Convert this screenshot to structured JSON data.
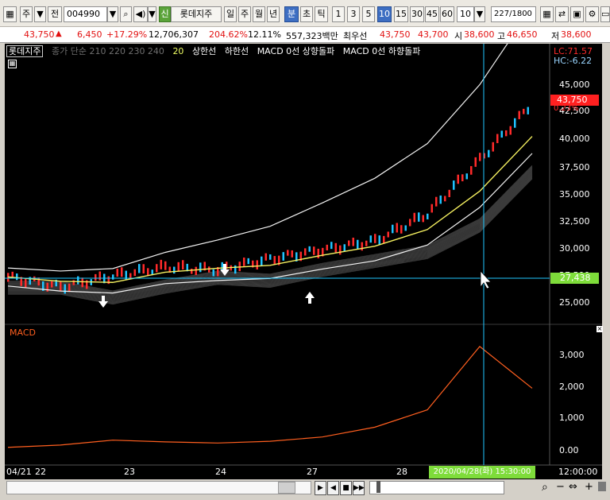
{
  "toolbar": {
    "mode": "주",
    "market": "전",
    "code": "004990",
    "badge": "신",
    "stock_name": "롯데지주",
    "periods": [
      "일",
      "주",
      "월",
      "년",
      "분",
      "초",
      "틱"
    ],
    "active_period": "분",
    "minutes": [
      "1",
      "3",
      "5",
      "10",
      "15",
      "30",
      "45",
      "60"
    ],
    "active_minute": "10",
    "interval": "10",
    "count": "227",
    "count_total": "/1800",
    "colors": {
      "active": "#3d6ec2",
      "badge": "#5aa339"
    }
  },
  "quote": {
    "price": "43,750",
    "arrow": "▲",
    "change": "6,450",
    "change_pct": "+17.29%",
    "volume": "12,706,307",
    "volume_ratio": "204.62%",
    "turnover": "12.11%",
    "amount": "557,323백만",
    "best_ask_label": "최우선",
    "best_ask": "43,750",
    "best_bid": "43,700",
    "open_label": "시",
    "open": "38,600",
    "high_label": "고",
    "high": "46,650",
    "low_label": "저",
    "low": "38,600"
  },
  "legend": {
    "stock": "롯데지주",
    "ma": "종가 단순 210 220 230 240",
    "n": "20",
    "upper": "상한선",
    "lower": "하한선",
    "macd_up": "MACD 0선 상향돌파",
    "macd_down": "MACD 0선 하향돌파"
  },
  "price_axis": {
    "labels": [
      "45,000",
      "42,500",
      "40,000",
      "37,500",
      "35,000",
      "32,500",
      "30,000",
      "27,500",
      "25,000"
    ],
    "lc": "LC:71.57",
    "hc": "HC:-6.22",
    "current": "43,750",
    "current_pct": "0.23%",
    "crosshair": "27,438"
  },
  "macd_panel": {
    "title": "MACD",
    "labels": [
      "3,000",
      "2,000",
      "1,000",
      "0.00"
    ],
    "close_mark": "×"
  },
  "time_axis": {
    "labels": [
      "04/21",
      "22",
      "23",
      "24",
      "27",
      "28"
    ],
    "crosshair": "2020/04/28(화) 15:30:00",
    "last": "12:00:00"
  },
  "chart_data": {
    "type": "line",
    "title": "",
    "price": {
      "x": [
        "04/21",
        "22",
        "23",
        "24",
        "27",
        "28"
      ],
      "close": [
        26500,
        25500,
        26600,
        27500,
        27200,
        28300,
        29200,
        30100,
        32800,
        38200,
        43750
      ],
      "ylim": [
        24000,
        47000
      ],
      "last": 43750
    },
    "macd": {
      "values": [
        0,
        80,
        250,
        190,
        150,
        210,
        360,
        700,
        1300,
        3500,
        2050
      ],
      "ylim": [
        -200,
        3800
      ]
    },
    "colors": {
      "up": "#ff2a2a",
      "down": "#1fc3ff",
      "ma": "#f5f060",
      "band": "#f2f2f2",
      "macd": "#ff5f1f",
      "cross": "#20c8ff"
    }
  }
}
